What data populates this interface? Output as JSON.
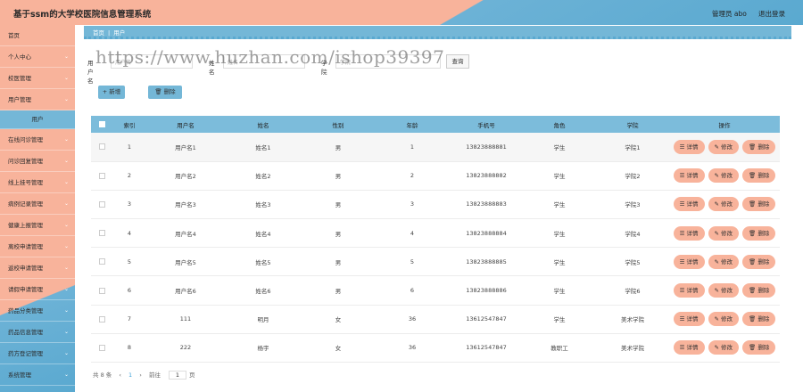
{
  "header": {
    "title": "基于ssm的大学校医院信息管理系统",
    "user": "管理员 abo",
    "logout": "退出登录"
  },
  "sidebar": [
    {
      "label": "首页",
      "arrow": false
    },
    {
      "label": "个人中心",
      "arrow": true
    },
    {
      "label": "校医管理",
      "arrow": true
    },
    {
      "label": "用户管理",
      "arrow": true
    },
    {
      "label": "用户",
      "arrow": false,
      "sub": true
    },
    {
      "label": "在线问诊管理",
      "arrow": true
    },
    {
      "label": "问诊回复管理",
      "arrow": true
    },
    {
      "label": "线上挂号管理",
      "arrow": true
    },
    {
      "label": "病例记录管理",
      "arrow": true
    },
    {
      "label": "健康上报管理",
      "arrow": true
    },
    {
      "label": "离校申请管理",
      "arrow": true
    },
    {
      "label": "返校申请管理",
      "arrow": true
    },
    {
      "label": "请假申请管理",
      "arrow": true
    },
    {
      "label": "药品分类管理",
      "arrow": true
    },
    {
      "label": "药品信息管理",
      "arrow": true
    },
    {
      "label": "药方登记管理",
      "arrow": true
    },
    {
      "label": "系统管理",
      "arrow": true
    }
  ],
  "breadcrumb": {
    "home": "首页",
    "sep": "|",
    "current": "用户"
  },
  "search": {
    "label1": "用户名",
    "placeholder1": "用户名",
    "label2": "姓名",
    "placeholder2": "姓名",
    "label3": "学院",
    "placeholder3": "学院",
    "query": "查询"
  },
  "watermark": "https://www.huzhan.com/ishop39397",
  "actions": {
    "add": "+ 新增",
    "delete": "🗑 删除"
  },
  "table": {
    "columns": [
      "索引",
      "用户名",
      "姓名",
      "性别",
      "年龄",
      "手机号",
      "角色",
      "学院",
      "操作"
    ],
    "ops": {
      "detail": "☰ 详情",
      "edit": "✎ 修改",
      "delete": "🗑 删除"
    },
    "rows": [
      [
        "1",
        "用户名1",
        "姓名1",
        "男",
        "1",
        "13823888881",
        "学生",
        "学院1"
      ],
      [
        "2",
        "用户名2",
        "姓名2",
        "男",
        "2",
        "13823888882",
        "学生",
        "学院2"
      ],
      [
        "3",
        "用户名3",
        "姓名3",
        "男",
        "3",
        "13823888883",
        "学生",
        "学院3"
      ],
      [
        "4",
        "用户名4",
        "姓名4",
        "男",
        "4",
        "13823888884",
        "学生",
        "学院4"
      ],
      [
        "5",
        "用户名5",
        "姓名5",
        "男",
        "5",
        "13823888885",
        "学生",
        "学院5"
      ],
      [
        "6",
        "用户名6",
        "姓名6",
        "男",
        "6",
        "13823888886",
        "学生",
        "学院6"
      ],
      [
        "7",
        "111",
        "明月",
        "女",
        "36",
        "13612547847",
        "学生",
        "美术学院"
      ],
      [
        "8",
        "222",
        "杨宇",
        "女",
        "36",
        "13612547847",
        "教职工",
        "美术学院"
      ]
    ]
  },
  "pager": {
    "total": "共 8 条",
    "prev": "‹",
    "page": "1",
    "next": "›",
    "goto": "前往",
    "jump": "1",
    "unit": "页"
  }
}
